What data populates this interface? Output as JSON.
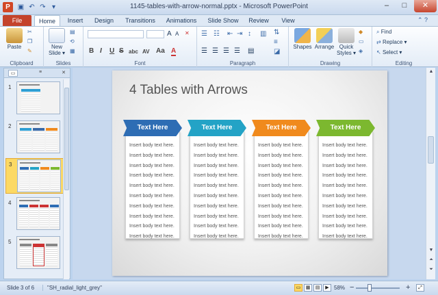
{
  "window": {
    "title": "1145-tables-with-arrow-normal.pptx - Microsoft PowerPoint",
    "app_logo": "P",
    "min": "–",
    "max": "□",
    "close": "✕"
  },
  "tabs": {
    "file": "File",
    "items": [
      "Home",
      "Insert",
      "Design",
      "Transitions",
      "Animations",
      "Slide Show",
      "Review",
      "View"
    ]
  },
  "ribbon": {
    "clipboard": {
      "paste": "Paste",
      "label": "Clipboard"
    },
    "slides": {
      "new_slide": "New",
      "new_slide2": "Slide ▾",
      "label": "Slides"
    },
    "font": {
      "label": "Font",
      "bold": "B",
      "italic": "I",
      "underline": "U",
      "strike": "S",
      "shadow": "abc",
      "spacing": "AV",
      "case": "Aa",
      "color": "A",
      "grow": "A",
      "shrink": "A"
    },
    "paragraph": {
      "label": "Paragraph"
    },
    "drawing": {
      "shapes": "Shapes",
      "arrange": "Arrange",
      "quick": "Quick",
      "styles": "Styles ▾",
      "label": "Drawing"
    },
    "editing": {
      "find": "Find",
      "replace": "Replace ▾",
      "select": "Select ▾",
      "label": "Editing"
    }
  },
  "thumbnails": [
    {
      "num": "1"
    },
    {
      "num": "2"
    },
    {
      "num": "3"
    },
    {
      "num": "4"
    },
    {
      "num": "5"
    }
  ],
  "slide": {
    "title": "4 Tables with Arrows",
    "columns": [
      {
        "header": "Text Here",
        "color": "#2e6db4",
        "rows": [
          "Insert body text here.",
          "Insert body text here.",
          "Insert body text here.",
          "Insert body text here.",
          "Insert body text here.",
          "Insert body text here.",
          "Insert body text here.",
          "Insert body text here.",
          "Insert body text here.",
          "Insert body text here."
        ]
      },
      {
        "header": "Text Here",
        "color": "#23a3c6",
        "rows": [
          "Insert body text here.",
          "Insert body text here.",
          "Insert body text here.",
          "Insert body text here.",
          "Insert body text here.",
          "Insert body text here.",
          "Insert body text here.",
          "Insert body text here.",
          "Insert body text here.",
          "Insert body text here."
        ]
      },
      {
        "header": "Text Here",
        "color": "#f08a1d",
        "rows": [
          "Insert body text here.",
          "Insert body text here.",
          "Insert body text here.",
          "Insert body text here.",
          "Insert body text here.",
          "Insert body text here.",
          "Insert body text here.",
          "Insert body text here.",
          "Insert body text here.",
          "Insert body text here."
        ]
      },
      {
        "header": "Text Here",
        "color": "#7cb82f",
        "rows": [
          "Insert body text here.",
          "Insert body text here.",
          "Insert body text here.",
          "Insert body text here.",
          "Insert body text here.",
          "Insert body text here.",
          "Insert body text here.",
          "Insert body text here.",
          "Insert body text here.",
          "Insert body text here."
        ]
      }
    ]
  },
  "status": {
    "slide": "Slide 3 of 6",
    "theme": "\"SH_radial_light_grey\"",
    "zoom": "58%",
    "zoom_minus": "−",
    "zoom_plus": "+"
  }
}
